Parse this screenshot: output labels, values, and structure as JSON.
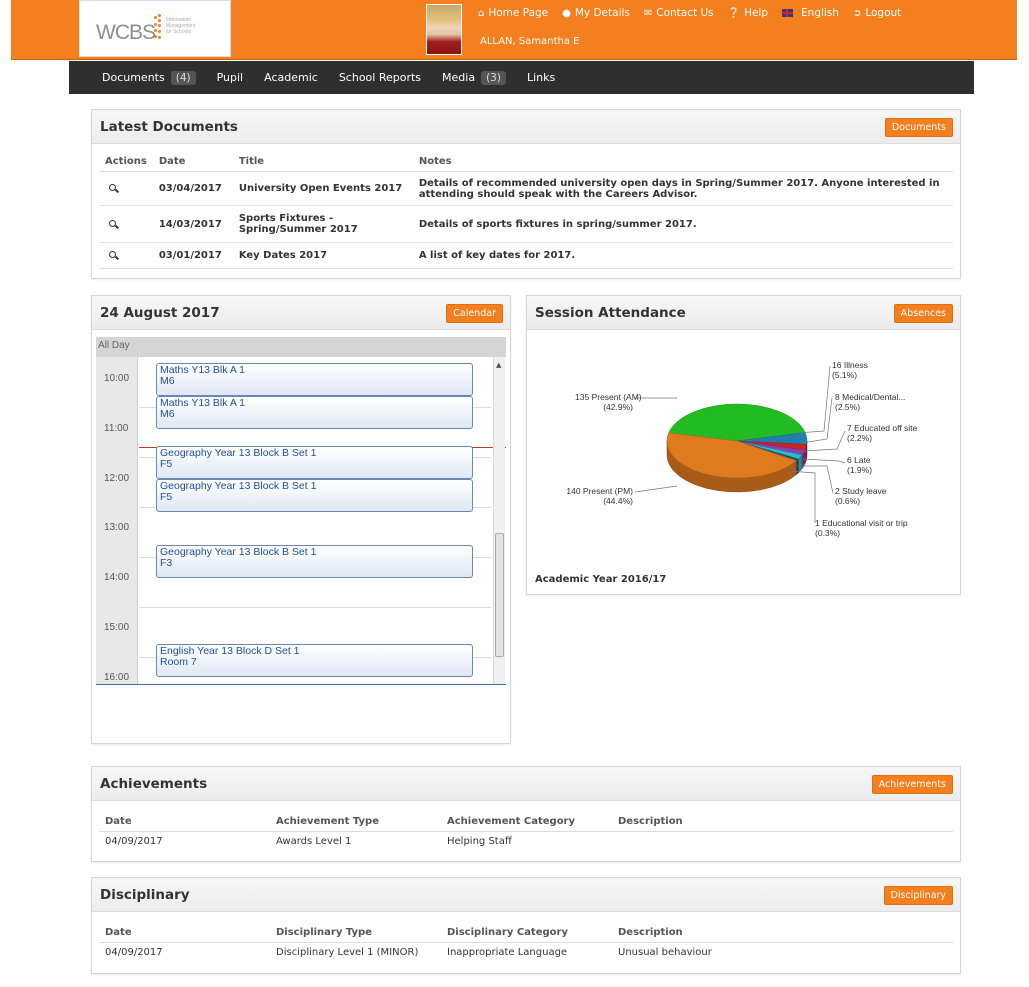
{
  "header": {
    "logo_text": "WCBS",
    "logo_subtitle": [
      "Information",
      "Management",
      "for Schools"
    ],
    "user_name": "ALLAN, Samantha E",
    "nav": [
      {
        "label": "Home Page",
        "icon": "home-icon"
      },
      {
        "label": "My Details",
        "icon": "user-icon"
      },
      {
        "label": "Contact Us",
        "icon": "envelope-icon"
      },
      {
        "label": "Help",
        "icon": "question-icon"
      },
      {
        "label": "English",
        "icon": "uk-flag-icon"
      },
      {
        "label": "Logout",
        "icon": "logout-icon"
      }
    ]
  },
  "navbar": {
    "items": [
      {
        "label": "Documents",
        "badge": "(4)"
      },
      {
        "label": "Pupil",
        "badge": ""
      },
      {
        "label": "Academic",
        "badge": ""
      },
      {
        "label": "School Reports",
        "badge": ""
      },
      {
        "label": "Media",
        "badge": "(3)"
      },
      {
        "label": "Links",
        "badge": ""
      }
    ]
  },
  "documents": {
    "title": "Latest Documents",
    "button": "Documents",
    "columns": [
      "Actions",
      "Date",
      "Title",
      "Notes"
    ],
    "rows": [
      {
        "date": "03/04/2017",
        "title": "University Open Events 2017",
        "notes": "Details of recommended university open days in Spring/Summer 2017. Anyone interested in attending should speak with the Careers Advisor."
      },
      {
        "date": "14/03/2017",
        "title": "Sports Fixtures - Spring/Summer 2017",
        "notes": "Details of sports fixtures in spring/summer 2017."
      },
      {
        "date": "03/01/2017",
        "title": "Key Dates 2017",
        "notes": "A list of key dates for 2017."
      }
    ]
  },
  "calendar": {
    "title": "24 August 2017",
    "button": "Calendar",
    "all_day": "All Day",
    "times": [
      "10:00",
      "11:00",
      "12:00",
      "13:00",
      "14:00",
      "15:00",
      "16:00"
    ],
    "events": [
      {
        "line1": "Maths Y13 Blk A 1",
        "line2": "M6"
      },
      {
        "line1": "Maths Y13 Blk A 1",
        "line2": "M6"
      },
      {
        "line1": "Geography Year 13 Block B Set 1",
        "line2": "F5"
      },
      {
        "line1": "Geography Year 13 Block B Set 1",
        "line2": "F5"
      },
      {
        "line1": "Geography Year 13 Block B Set 1",
        "line2": "F3"
      },
      {
        "line1": "English Year 13 Block D Set 1",
        "line2": "Room 7"
      }
    ]
  },
  "attendance": {
    "title": "Session Attendance",
    "button": "Absences",
    "footer": "Academic Year 2016/17"
  },
  "chart_data": {
    "type": "pie",
    "title": "",
    "slices": [
      {
        "label": "Present (AM)",
        "value": 135,
        "percent": "42.9%",
        "color": "#22bb22"
      },
      {
        "label": "Present (PM)",
        "value": 140,
        "percent": "44.4%",
        "color": "#e07a1f"
      },
      {
        "label": "Illness",
        "value": 16,
        "percent": "5.1%",
        "color": "#1f7fb0"
      },
      {
        "label": "Medical/Dental...",
        "value": 8,
        "percent": "2.5%",
        "color": "#cc2222"
      },
      {
        "label": "Educated off site",
        "value": 7,
        "percent": "2.2%",
        "color": "#8a3fb5"
      },
      {
        "label": "Late",
        "value": 6,
        "percent": "1.9%",
        "color": "#22c0c0"
      },
      {
        "label": "Study leave",
        "value": 2,
        "percent": "0.6%",
        "color": "#444444"
      },
      {
        "label": "Educational visit or trip",
        "value": 1,
        "percent": "0.3%",
        "color": "#6a6ad0"
      }
    ]
  },
  "achievements": {
    "title": "Achievements",
    "button": "Achievements",
    "columns": [
      "Date",
      "Achievement Type",
      "Achievement Category",
      "Description"
    ],
    "rows": [
      {
        "date": "04/09/2017",
        "type": "Awards Level 1",
        "category": "Helping Staff",
        "description": ""
      }
    ]
  },
  "disciplinary": {
    "title": "Disciplinary",
    "button": "Disciplinary",
    "columns": [
      "Date",
      "Disciplinary Type",
      "Disciplinary Category",
      "Description"
    ],
    "rows": [
      {
        "date": "04/09/2017",
        "type": "Disciplinary Level 1 (MINOR)",
        "category": "Inappropriate Language",
        "description": "Unusual behaviour"
      }
    ]
  },
  "colors": {
    "accent": "#f47f1f",
    "navbar": "#2f2f2f",
    "event_text": "#1f4f9a"
  }
}
